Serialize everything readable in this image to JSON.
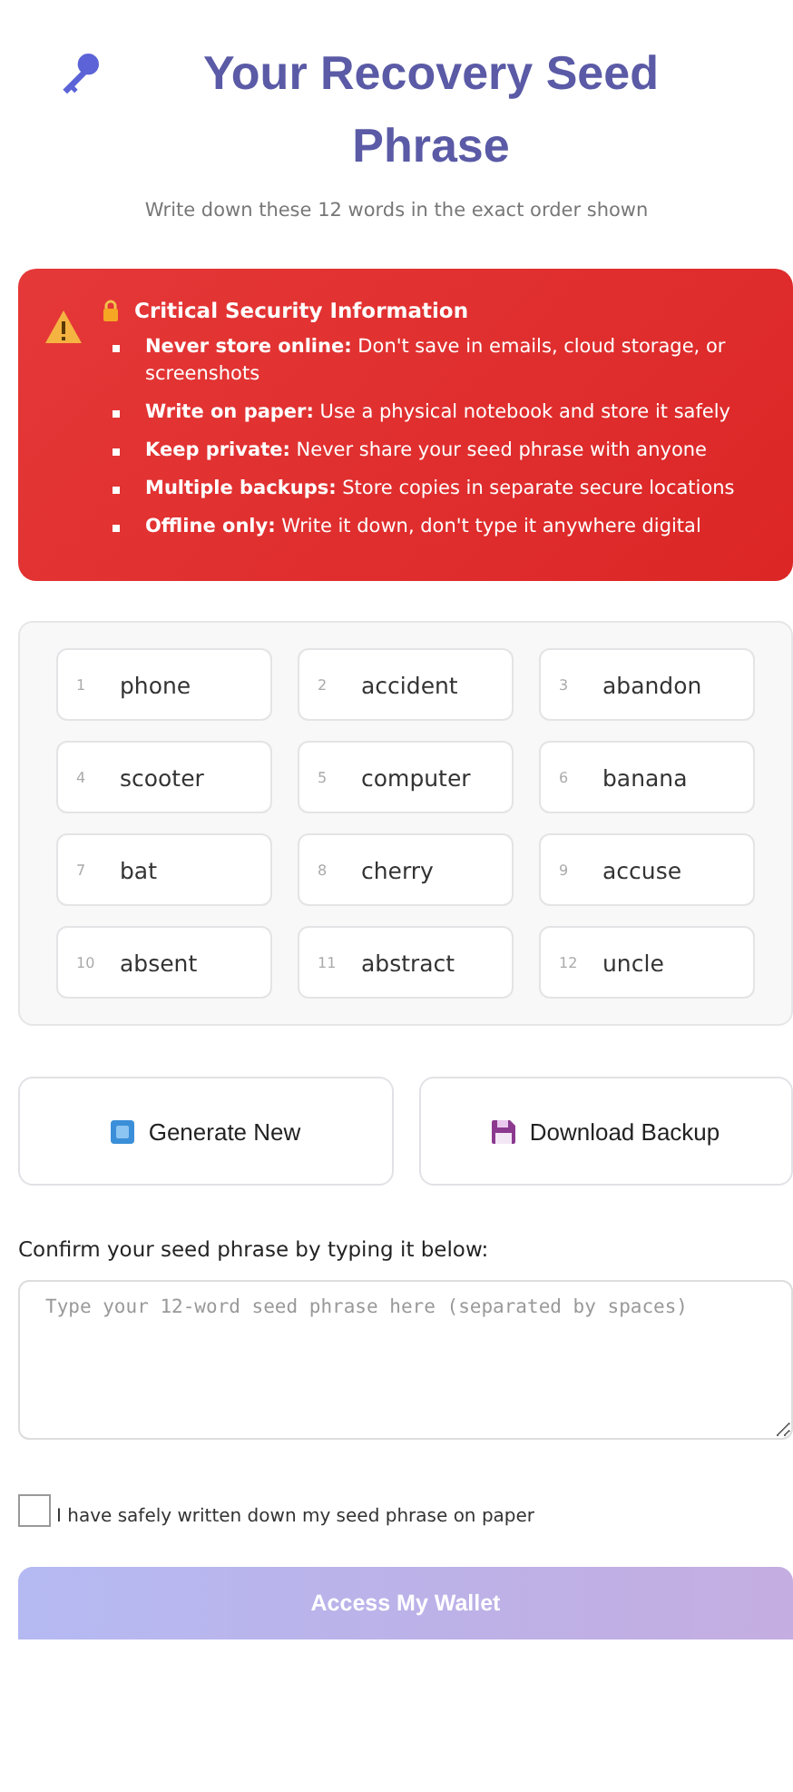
{
  "title": "Your Recovery Seed Phrase",
  "subtitle": "Write down these 12 words in the exact order shown",
  "warning": {
    "title": "Critical Security Information",
    "items": [
      "**Never store online:** Don't save in emails, cloud storage, or screenshots",
      "**Write on paper:** Use a physical notebook and store it safely",
      "**Keep private:** Never share your seed phrase with anyone",
      "**Multiple backups:** Store copies in separate secure locations",
      "**Offline only:** Write it down, don't type it anywhere digital"
    ]
  },
  "words": [
    {
      "index": "1",
      "word": "phone"
    },
    {
      "index": "2",
      "word": "accident"
    },
    {
      "index": "3",
      "word": "abandon"
    },
    {
      "index": "4",
      "word": "scooter"
    },
    {
      "index": "5",
      "word": "computer"
    },
    {
      "index": "6",
      "word": "banana"
    },
    {
      "index": "7",
      "word": "bat"
    },
    {
      "index": "8",
      "word": "cherry"
    },
    {
      "index": "9",
      "word": "accuse"
    },
    {
      "index": "10",
      "word": "absent"
    },
    {
      "index": "11",
      "word": "abstract"
    },
    {
      "index": "12",
      "word": "uncle"
    }
  ],
  "buttons": [
    {
      "kind": "generate",
      "label": "Generate New"
    },
    {
      "kind": "download",
      "label": "Download Backup"
    }
  ],
  "confirm": {
    "label": "Confirm your seed phrase by typing it below:",
    "placeholder": "Type your 12-word seed phrase here (separated by spaces)"
  },
  "acknowledge": {
    "label": "I have safely written down my seed phrase on paper",
    "checked": false
  },
  "submit": {
    "label": "Access My Wallet",
    "disabled": true
  }
}
